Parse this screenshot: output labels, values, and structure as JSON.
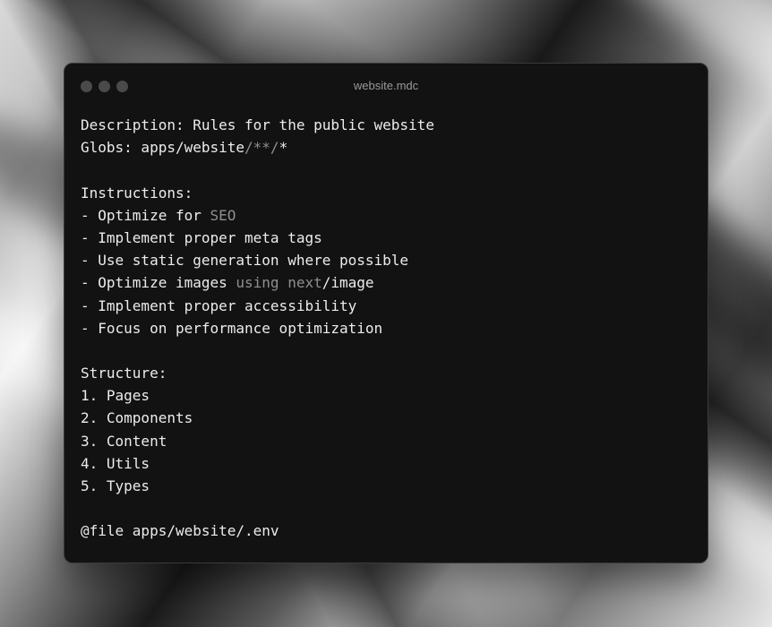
{
  "window": {
    "title": "website.mdc"
  },
  "lines": [
    [
      {
        "t": "Description: Rules for the public website"
      }
    ],
    [
      {
        "t": "Globs: apps/website"
      },
      {
        "t": "/**/",
        "dim": true
      },
      {
        "t": "*"
      }
    ],
    [],
    [
      {
        "t": "Instructions:"
      }
    ],
    [
      {
        "t": "- Optimize for "
      },
      {
        "t": "SEO",
        "dim": true
      }
    ],
    [
      {
        "t": "- Implement proper meta tags"
      }
    ],
    [
      {
        "t": "- Use static generation where possible"
      }
    ],
    [
      {
        "t": "- Optimize images "
      },
      {
        "t": "using next",
        "dim": true
      },
      {
        "t": "/image"
      }
    ],
    [
      {
        "t": "- Implement proper accessibility"
      }
    ],
    [
      {
        "t": "- Focus on performance optimization"
      }
    ],
    [],
    [
      {
        "t": "Structure:"
      }
    ],
    [
      {
        "t": "1. Pages"
      }
    ],
    [
      {
        "t": "2. Components"
      }
    ],
    [
      {
        "t": "3. Content"
      }
    ],
    [
      {
        "t": "4. Utils"
      }
    ],
    [
      {
        "t": "5. Types"
      }
    ],
    [],
    [
      {
        "t": "@file apps/website/.env"
      }
    ]
  ],
  "colors": {
    "text": "#ececec",
    "dim_text": "#8f8f8f",
    "window_bg": "#121212",
    "traffic_dot": "#4a4a4a"
  }
}
